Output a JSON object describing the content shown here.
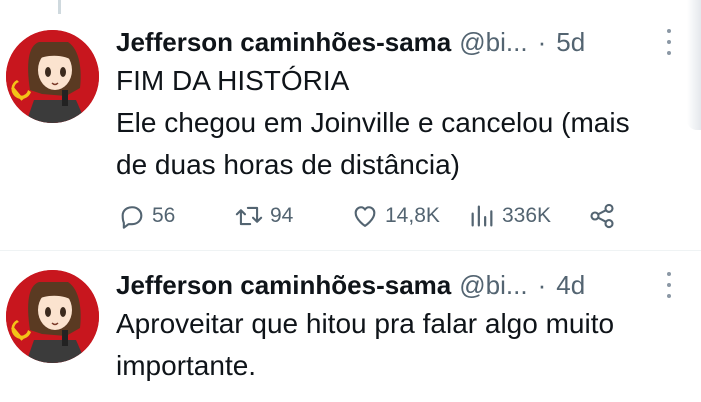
{
  "tweets": [
    {
      "display_name": "Jefferson caminhões-sama",
      "handle": "@bi...",
      "separator": "·",
      "time": "5d",
      "title_line": "FIM DA HISTÓRIA",
      "body_lines": [
        "Ele chegou em Joinville e cancelou (mais",
        "de duas horas de distância)"
      ],
      "actions": {
        "replies": "56",
        "retweets": "94",
        "likes": "14,8K",
        "views": "336K"
      },
      "icons": [
        "reply-icon",
        "retweet-icon",
        "like-icon",
        "views-icon",
        "share-icon",
        "more-icon"
      ]
    },
    {
      "display_name": "Jefferson caminhões-sama",
      "handle": "@bi...",
      "separator": "·",
      "time": "4d",
      "body_lines": [
        "Aproveitar que hitou pra falar algo muito",
        "importante."
      ]
    }
  ],
  "colors": {
    "text_primary": "#0f1419",
    "text_secondary": "#536471",
    "avatar_background": "#c8161e",
    "emblem": "#f3c318"
  }
}
